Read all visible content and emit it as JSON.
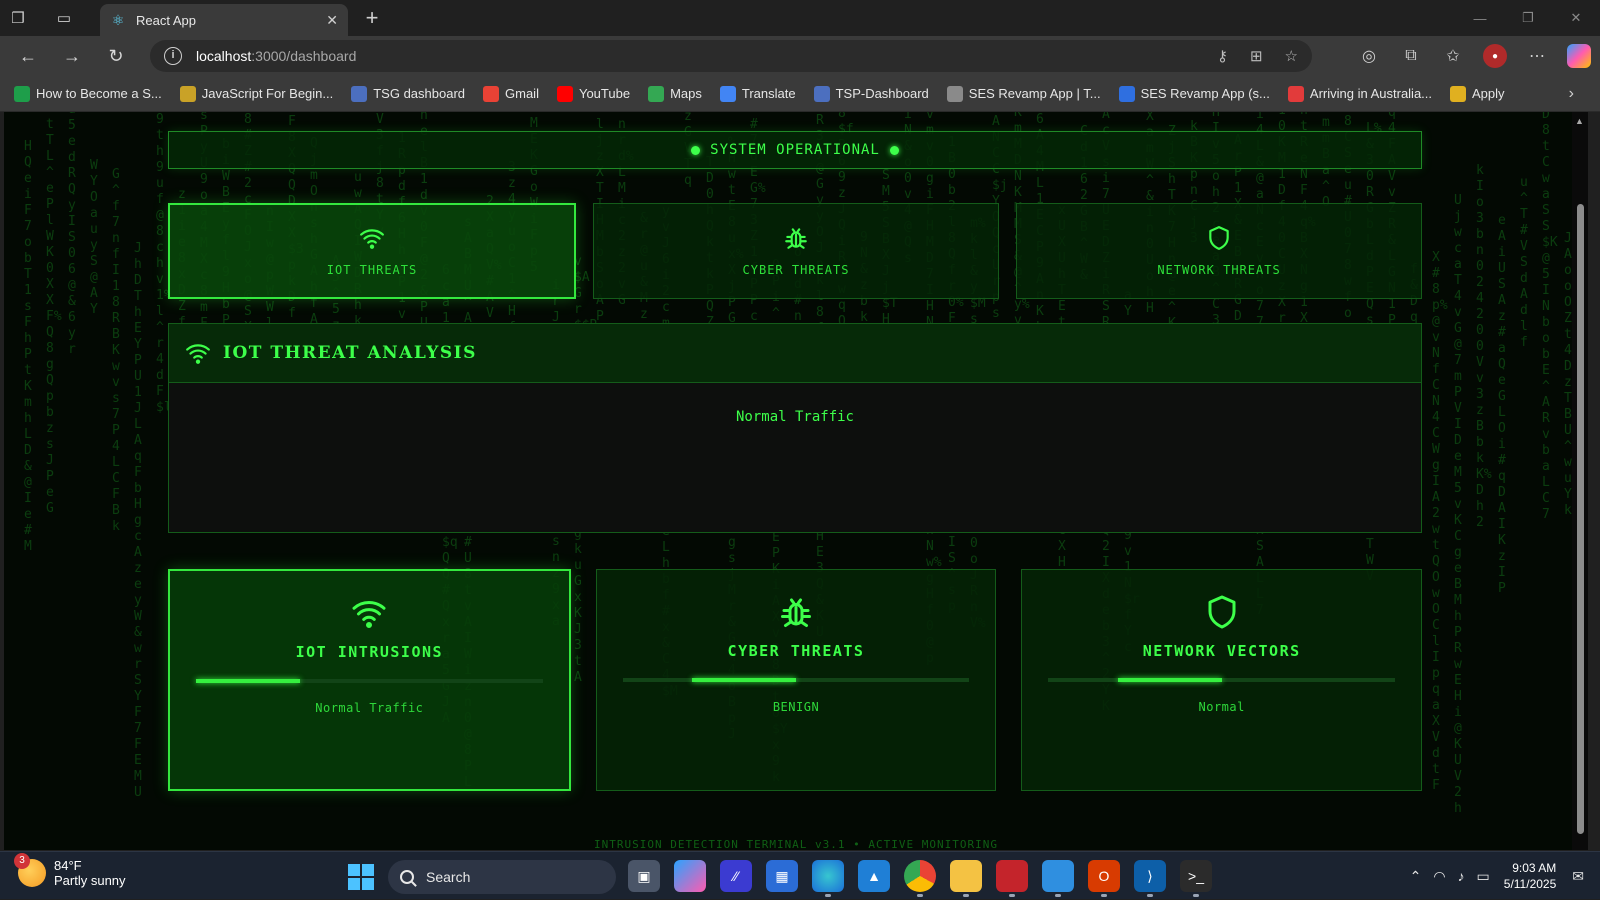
{
  "browser": {
    "tab_title": "React App",
    "address_host": "localhost",
    "address_path": ":3000/dashboard",
    "bookmarks": [
      {
        "label": "How to Become a S...",
        "color": "#1e9e4a"
      },
      {
        "label": "JavaScript For Begin...",
        "color": "#c9a227"
      },
      {
        "label": "TSG dashboard",
        "color": "#4c6fbf"
      },
      {
        "label": "Gmail",
        "color": "#e94235"
      },
      {
        "label": "YouTube",
        "color": "#ff0000"
      },
      {
        "label": "Maps",
        "color": "#34a853"
      },
      {
        "label": "Translate",
        "color": "#4285f4"
      },
      {
        "label": "TSP-Dashboard",
        "color": "#4c6fbf"
      },
      {
        "label": "SES Revamp App | T...",
        "color": "#8a8a8a"
      },
      {
        "label": "SES Revamp App (s...",
        "color": "#2f6fe0"
      },
      {
        "label": "Arriving in Australia...",
        "color": "#e23b3b"
      },
      {
        "label": "Apply",
        "color": "#e0b020"
      }
    ]
  },
  "dashboard": {
    "status": "SYSTEM OPERATIONAL",
    "tabs": [
      {
        "label": "IOT THREATS",
        "icon": "wifi-icon",
        "active": true
      },
      {
        "label": "CYBER THREATS",
        "icon": "bug-icon",
        "active": false
      },
      {
        "label": "NETWORK THREATS",
        "icon": "shield-icon",
        "active": false
      }
    ],
    "analysis": {
      "title": "IOT THREAT ANALYSIS",
      "result": "Normal Traffic"
    },
    "metrics": [
      {
        "title": "IOT INTRUSIONS",
        "value": "Normal Traffic",
        "icon": "wifi-icon",
        "level": 0.3,
        "offset": 0.0
      },
      {
        "title": "CYBER THREATS",
        "value": "BENIGN",
        "icon": "bug-icon",
        "level": 0.3,
        "offset": 0.2
      },
      {
        "title": "NETWORK VECTORS",
        "value": "Normal",
        "icon": "shield-icon",
        "level": 0.3,
        "offset": 0.2
      }
    ],
    "footer": "INTRUSION DETECTION TERMINAL v3.1 • ACTIVE MONITORING",
    "accent_color": "#3dff4a"
  },
  "taskbar": {
    "weather_temp": "84°F",
    "weather_desc": "Partly sunny",
    "weather_badge": "3",
    "search_label": "Search",
    "time": "9:03 AM",
    "date": "5/11/2025"
  }
}
